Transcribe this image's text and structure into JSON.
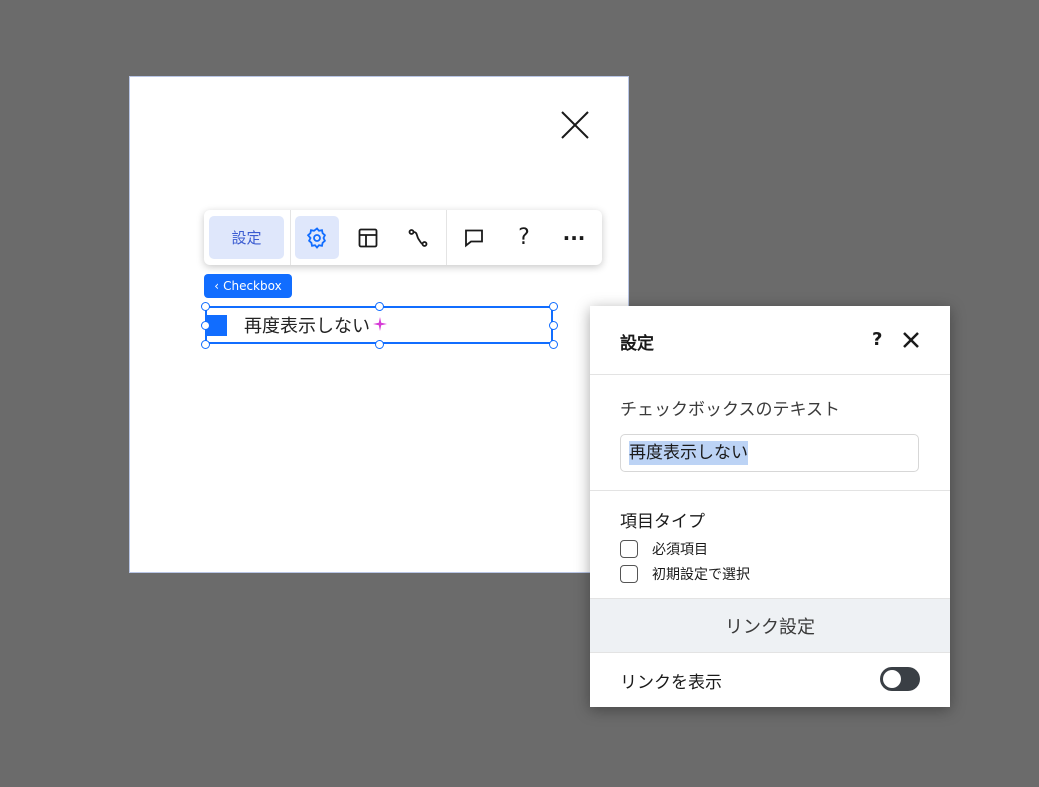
{
  "toolbar": {
    "settings_label": "設定",
    "icons": [
      "gear-icon",
      "layout-icon",
      "connect-icon",
      "comment-icon",
      "help-icon",
      "more-icon"
    ],
    "help_glyph": "?",
    "more_glyph": "···"
  },
  "element_tag": {
    "chevron": "‹",
    "label": "Checkbox"
  },
  "checkbox_element": {
    "text": "再度表示しない"
  },
  "panel": {
    "title": "設定",
    "help": "?",
    "text_field_label": "チェックボックスのテキスト",
    "text_field_value": "再度表示しない",
    "item_type_label": "項目タイプ",
    "options": [
      {
        "label": "必須項目",
        "checked": false
      },
      {
        "label": "初期設定で選択",
        "checked": false
      }
    ],
    "link_section_title": "リンク設定",
    "show_link_label": "リンクを表示",
    "show_link_on": false
  },
  "colors": {
    "accent": "#116dff",
    "toolbar_active": "#dfe7fb",
    "background": "#6b6b6b",
    "toggle": "#3a3f45"
  }
}
